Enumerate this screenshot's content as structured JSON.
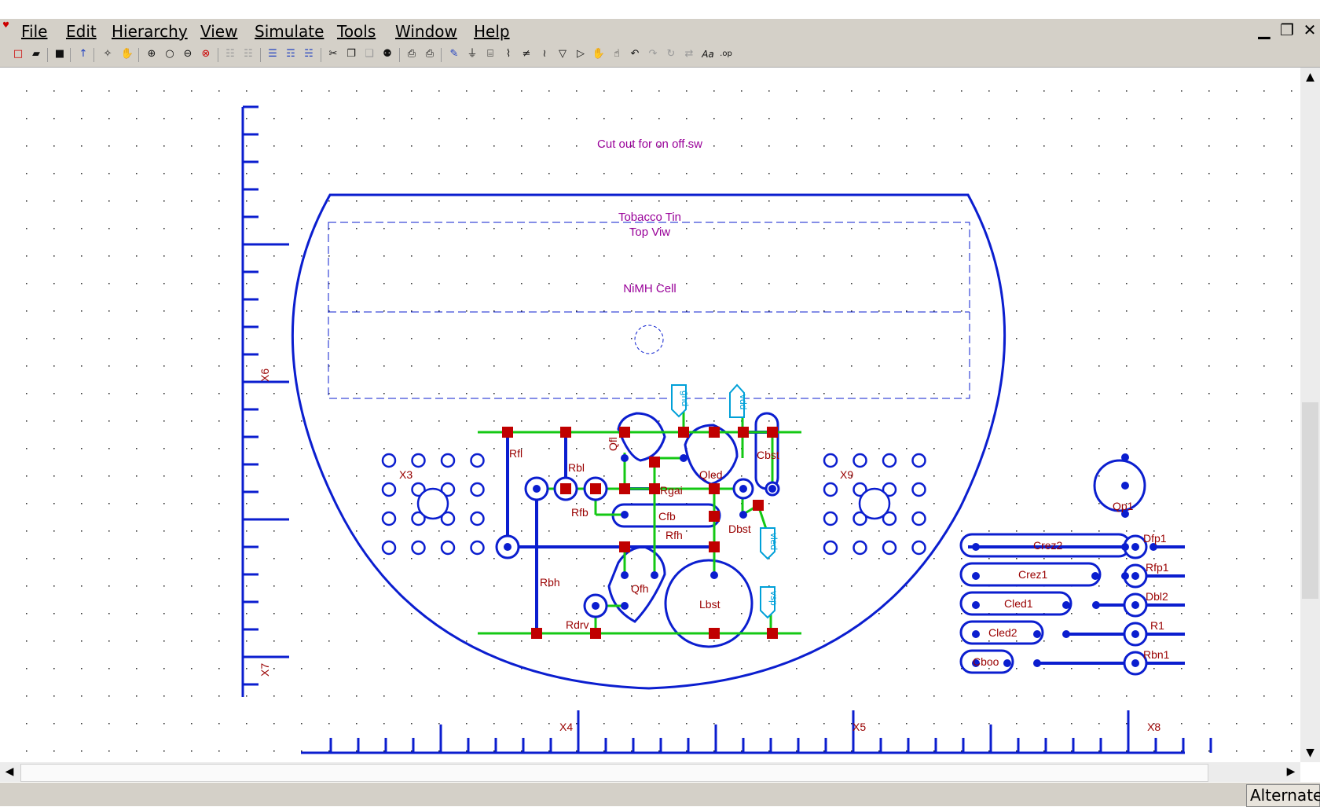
{
  "menu": [
    "File",
    "Edit",
    "Hierarchy",
    "View",
    "Simulate",
    "Tools",
    "Window",
    "Help"
  ],
  "window_controls": {
    "minimize": "▁",
    "restore": "❐",
    "close": "✕"
  },
  "toolbar_icons": [
    "new-icon",
    "open-icon",
    "save-icon",
    "hierarchy-icon",
    "probe-icon",
    "pan-icon",
    "zoom-in-icon",
    "zoom-icon",
    "zoom-out-icon",
    "zoom-fit-icon",
    "cut-icon",
    "copy-icon",
    "paste-icon",
    "find-icon",
    "print-preview-icon",
    "print-icon",
    "wire-icon",
    "ground-icon",
    "label-icon",
    "resistor-icon",
    "capacitor-icon",
    "inductor-icon",
    "diode-icon",
    "component-icon",
    "drag-icon",
    "move-icon",
    "undo-icon",
    "redo-icon",
    "rotate-icon",
    "mirror-icon",
    "text-icon",
    "spice-directive-icon"
  ],
  "canvas": {
    "labels": {
      "cutout": "Cut out for on off sw",
      "tin_title": "Tobacco Tin",
      "tin_subtitle": "Top Viw",
      "cell": "NiMH Cell",
      "x3": "X3",
      "x9": "X9",
      "x4": "X4",
      "x5": "X5",
      "x8": "X8",
      "x6": "X6",
      "x7": "X7"
    },
    "components": {
      "rfl": "Rfl",
      "rbl": "Rbl",
      "qfl": "Qfl",
      "qled": "Qled",
      "cbst": "Cbst",
      "rgai": "Rgai",
      "rfb": "Rfb",
      "cfb": "Cfb",
      "rfh": "Rfh",
      "dbst": "Dbst",
      "rbh": "Rbh",
      "qfh": "Qfh",
      "lbst": "Lbst",
      "rdrv": "Rdrv",
      "qp1": "Qp1",
      "crez2": "Crez2",
      "crez1": "Crez1",
      "cled1": "Cled1",
      "cled2": "Cled2",
      "cboo": "Cboo",
      "dfp1": "Dfp1",
      "rfp1": "Rfp1",
      "dbl2": "Dbl2",
      "r1": "R1",
      "rbn1": "Rbn1"
    },
    "ports": {
      "gnd": "gnd",
      "vdd": "vdd",
      "vled": "vled",
      "vsp": "vsp"
    }
  },
  "status": {
    "mode": "Alternate"
  },
  "colors": {
    "copper": "#0b1ecf",
    "wire": "#14c814",
    "pad": "#c00000",
    "label": "#990000",
    "annotation": "#990099",
    "port": "#00a0d8",
    "chrome": "#d4d0c8"
  }
}
